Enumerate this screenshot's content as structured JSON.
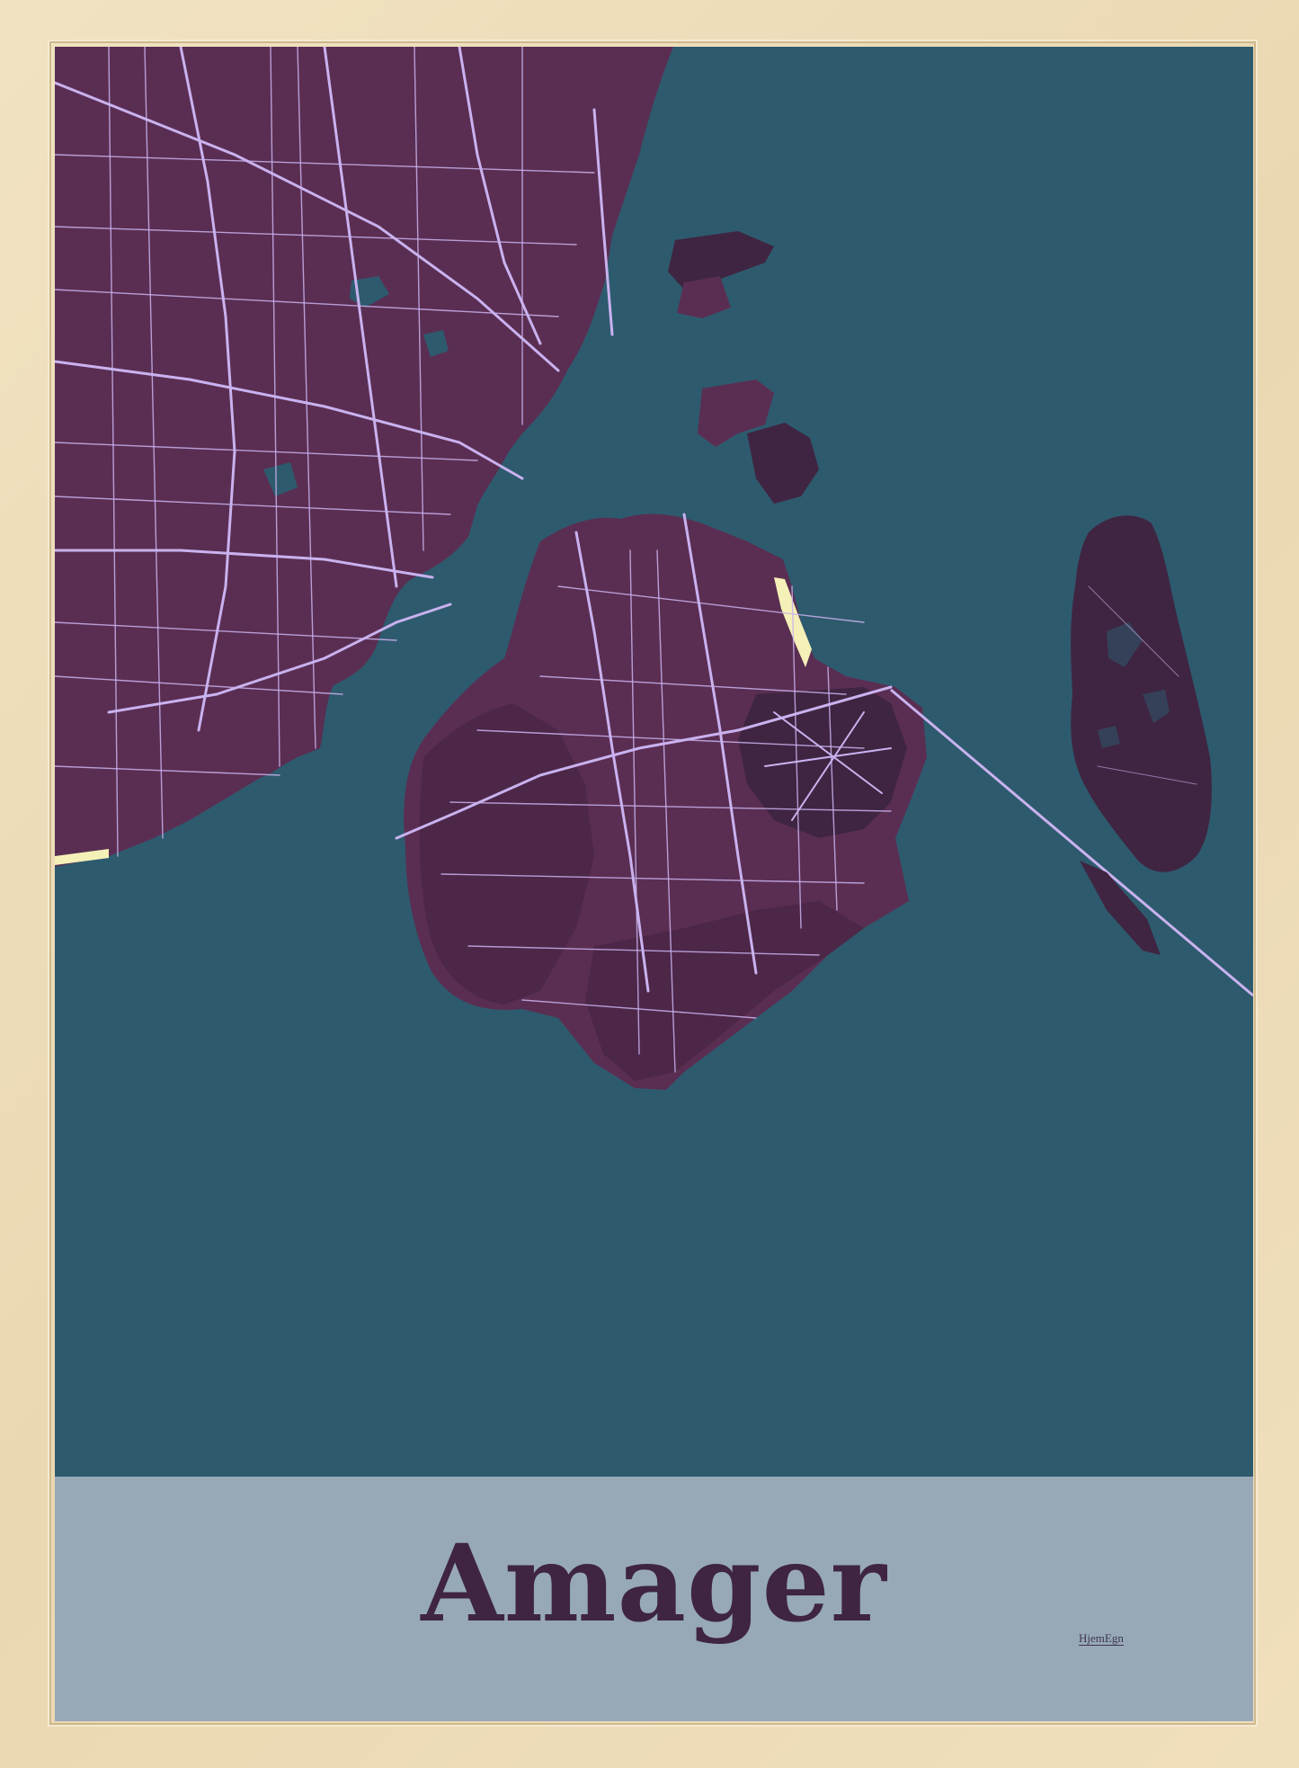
{
  "poster": {
    "title": "Amager",
    "brand": "HjemEgn"
  },
  "colors": {
    "frame": "#eddcb9",
    "water": "#2e5a6e",
    "land": "#5a2e52",
    "land_dark": "#3f2541",
    "roads": "#c9b2ef",
    "beach": "#f4f0b8",
    "label_panel": "#97a9b7",
    "title_text": "#3f2541"
  }
}
